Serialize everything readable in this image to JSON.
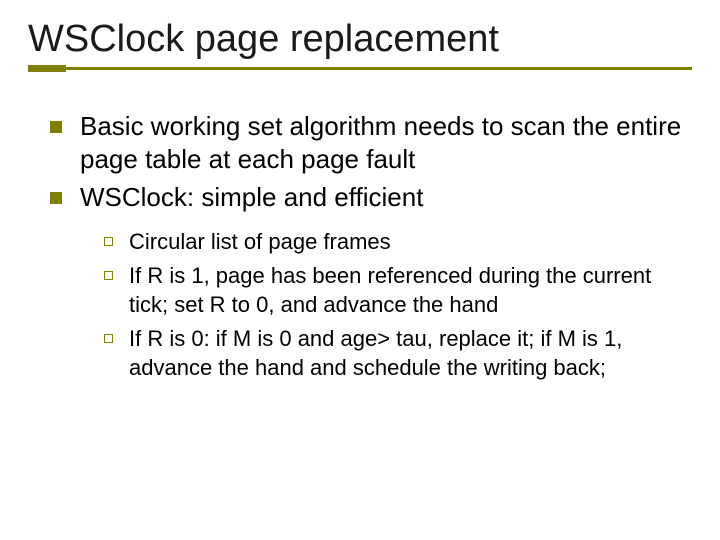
{
  "title": "WSClock page replacement",
  "bullets": [
    {
      "text": "Basic working set algorithm needs to scan the entire page table at each page fault"
    },
    {
      "text": "WSClock: simple and efficient"
    }
  ],
  "subbullets": [
    {
      "text": "Circular list of page frames"
    },
    {
      "text": "If R is 1, page has been referenced during the current tick; set R to 0, and advance the hand"
    },
    {
      "text": "If R is 0: if M is 0 and age> tau, replace it; if M is 1, advance the hand and schedule the writing back;"
    }
  ],
  "colors": {
    "accent": "#808000"
  }
}
